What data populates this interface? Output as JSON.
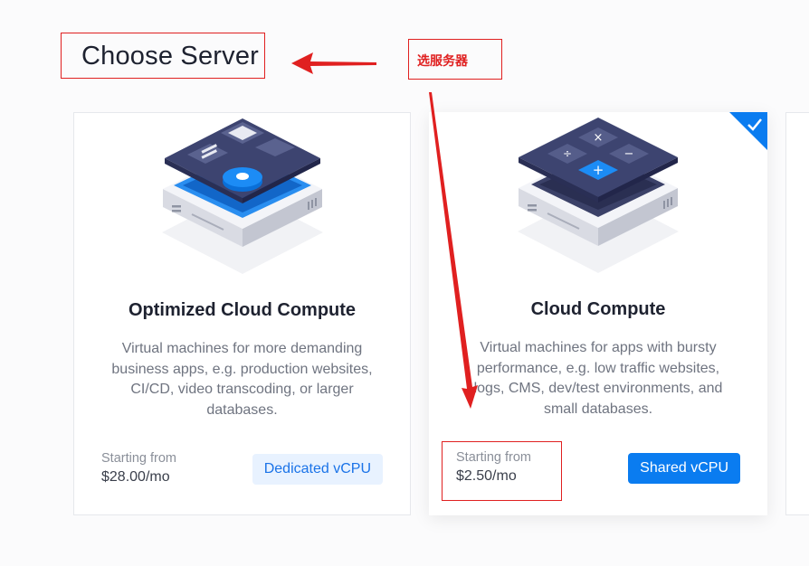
{
  "header": {
    "title": "Choose Server"
  },
  "annotation": {
    "label": "选服务器"
  },
  "cards": [
    {
      "title": "Optimized Cloud Compute",
      "description": "Virtual machines for more demanding business apps, e.g. production websites, CI/CD, video transcoding, or larger databases.",
      "starting_label": "Starting from",
      "price": "$28.00/mo",
      "badge": "Dedicated vCPU",
      "selected": false,
      "icon": "chip-server-icon"
    },
    {
      "title": "Cloud Compute",
      "description": "Virtual machines for apps with bursty performance, e.g. low traffic websites, logs, CMS, dev/test environments, and small databases.",
      "starting_label": "Starting from",
      "price": "$2.50/mo",
      "badge": "Shared vCPU",
      "selected": true,
      "icon": "calculator-server-icon"
    }
  ],
  "colors": {
    "accent": "#0a7cf0",
    "annotation": "#e02020",
    "badge_light_bg": "#e8f2ff"
  }
}
